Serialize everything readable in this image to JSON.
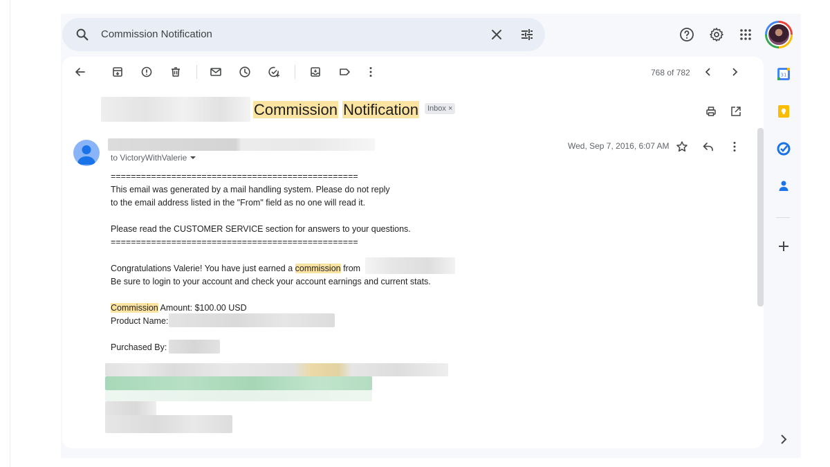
{
  "search": {
    "query": "Commission Notification",
    "icons": [
      "search-icon",
      "close-icon",
      "tune-icon"
    ]
  },
  "topbar": {
    "icons": [
      "help-icon",
      "gear-icon",
      "apps-grid-icon"
    ]
  },
  "toolbar": {
    "icons": [
      "back-arrow-icon",
      "archive-icon",
      "report-spam-icon",
      "delete-icon",
      "mark-unread-icon",
      "snooze-icon",
      "add-task-icon",
      "move-to-icon",
      "label-icon",
      "more-vert-icon"
    ],
    "pager_text": "768 of 782"
  },
  "email": {
    "subject_part1": "Commission",
    "subject_part2": "Notification",
    "inbox_chip": "Inbox ×",
    "to_line": "to VictoryWithValerie",
    "date": "Wed, Sep 7, 2016, 6:07 AM",
    "divider_line": "=================================================",
    "line1": "This email was generated by a mail handling system.  Please do not reply",
    "line2": "to the email address listed in the \"From\" field as no one will read it.",
    "line3": "Please read the CUSTOMER SERVICE section for answers to your questions.",
    "line4_pre": "Congratulations Valerie!  You have just earned a ",
    "line4_hl": "commission",
    "line4_post": " from",
    "line5": "Be sure to login to your account and check your account earnings and current stats.",
    "commission_hl": "Commission",
    "amount_rest": " Amount: $100.00 USD",
    "product_label": "Product Name:",
    "purchased_label": "Purchased By:"
  },
  "sidepanel": {
    "icons": [
      "calendar-icon",
      "keep-icon",
      "tasks-icon",
      "contacts-icon",
      "plus-icon",
      "chevron-right-icon"
    ]
  },
  "colors": {
    "highlight": "#fbe3a1",
    "frame_bg": "#f6f8fc",
    "search_bg": "#e9eef6"
  }
}
